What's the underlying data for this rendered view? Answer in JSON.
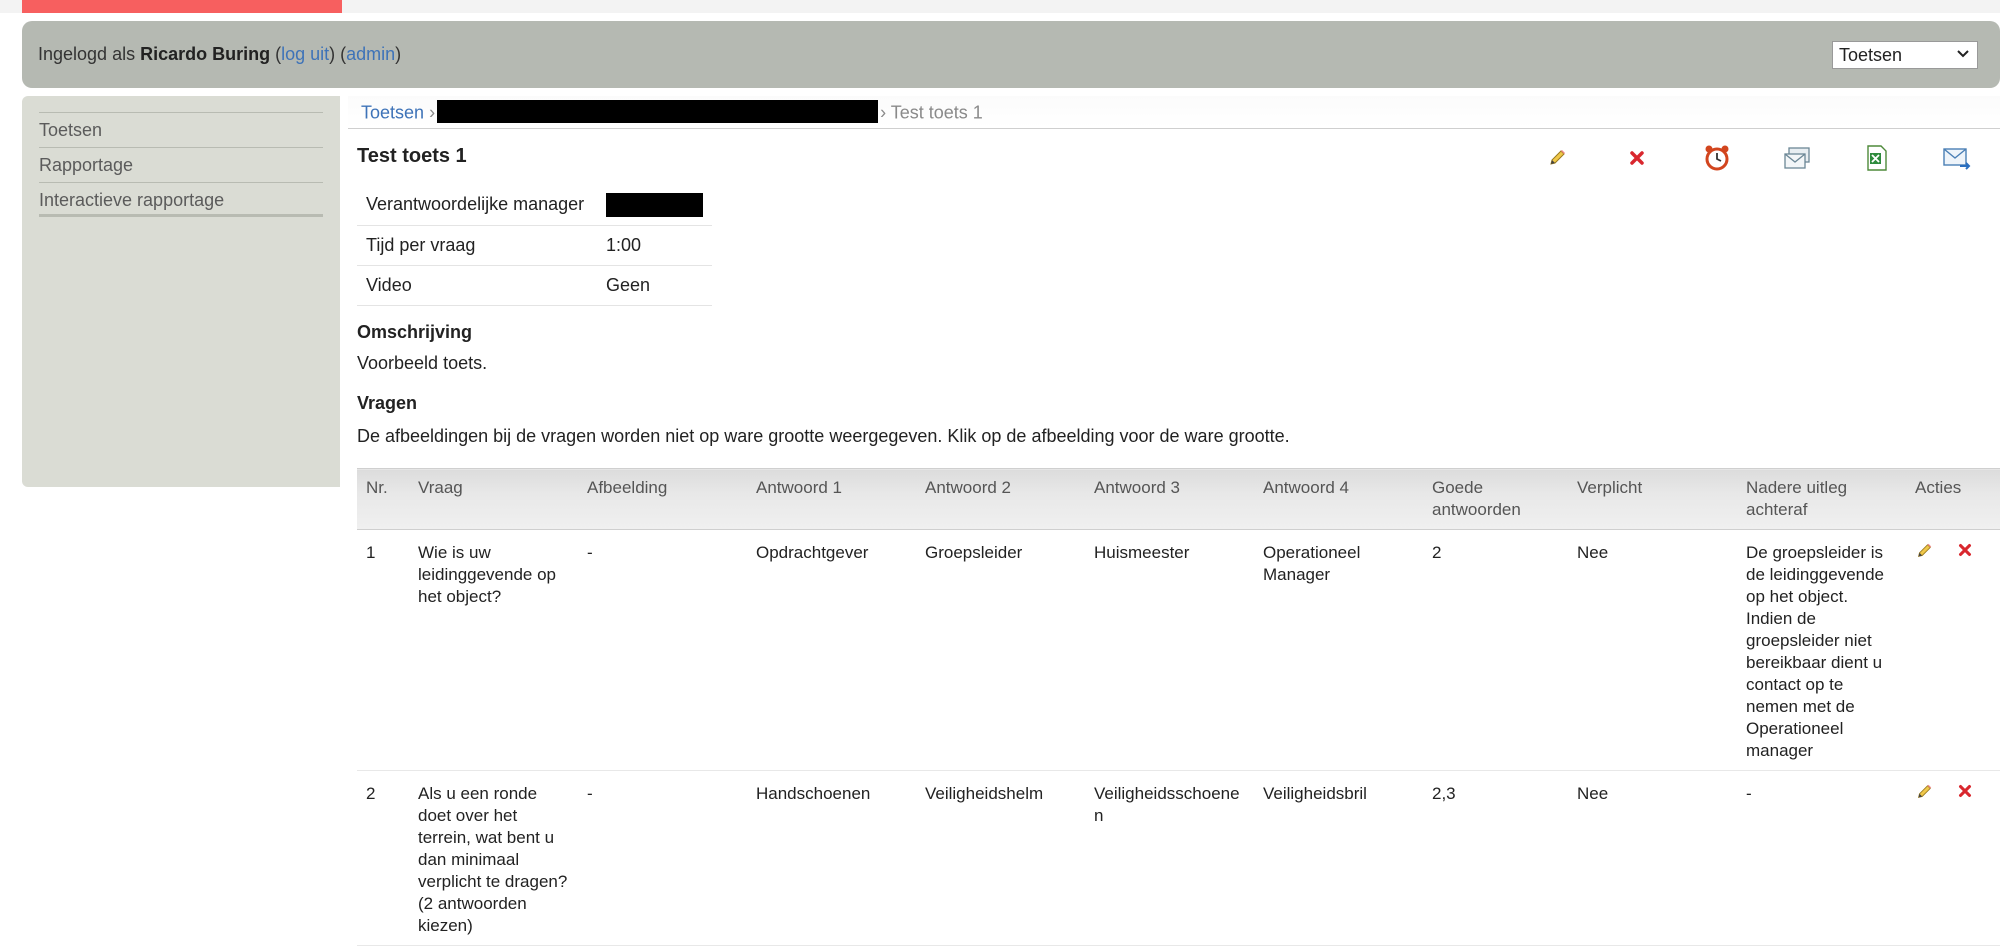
{
  "user": {
    "prefix": "Ingelogd als ",
    "name": "Ricardo Buring",
    "logout_label": "log uit",
    "admin_label": "admin"
  },
  "module_select": {
    "value": "Toetsen"
  },
  "sidebar": {
    "items": [
      {
        "label": "Toetsen"
      },
      {
        "label": "Rapportage"
      },
      {
        "label": "Interactieve rapportage"
      }
    ]
  },
  "breadcrumb": {
    "root": "Toetsen",
    "separator": "›",
    "current": "Test toets 1"
  },
  "page": {
    "title": "Test toets 1"
  },
  "toolbar": {
    "icons": [
      "pencil-icon",
      "delete-icon",
      "alarm-clock-icon",
      "envelopes-icon",
      "excel-icon",
      "send-mail-icon"
    ]
  },
  "details": [
    {
      "key": "Verantwoordelijke manager",
      "value": ""
    },
    {
      "key": "Tijd per vraag",
      "value": "1:00"
    },
    {
      "key": "Video",
      "value": "Geen"
    }
  ],
  "description": {
    "heading": "Omschrijving",
    "text": "Voorbeeld toets."
  },
  "questions_section": {
    "heading": "Vragen",
    "note": "De afbeeldingen bij de vragen worden niet op ware grootte weergegeven. Klik op de afbeelding voor de ware grootte."
  },
  "table": {
    "headers": [
      "Nr.",
      "Vraag",
      "Afbeelding",
      "Antwoord 1",
      "Antwoord 2",
      "Antwoord 3",
      "Antwoord 4",
      "Goede antwoorden",
      "Verplicht",
      "Nadere uitleg achteraf",
      "Acties"
    ],
    "rows": [
      {
        "nr": "1",
        "vraag": "Wie is uw leidinggevende op het object?",
        "afbeelding": "-",
        "a1": "Opdrachtgever",
        "a2": "Groepsleider",
        "a3": "Huismeester",
        "a4": "Operationeel Manager",
        "goed": "2",
        "verplicht": "Nee",
        "uitleg": "De groepsleider is de leidinggevende op het object. Indien de groepsleider niet bereikbaar dient u contact op te nemen met de Operationeel manager"
      },
      {
        "nr": "2",
        "vraag": "Als u een ronde doet over het terrein, wat bent u dan minimaal verplicht te dragen? (2 antwoorden kiezen)",
        "afbeelding": "-",
        "a1": "Handschoenen",
        "a2": "Veiligheidshelm",
        "a3": "Veiligheidsschoenen",
        "a4": "Veiligheidsbril",
        "goed": "2,3",
        "verplicht": "Nee",
        "uitleg": "-"
      }
    ]
  },
  "colors": {
    "accent": "#f75f5f",
    "userbar": "#b5b9b2",
    "sidebar": "#dadcd4",
    "link": "#3e73b8"
  }
}
